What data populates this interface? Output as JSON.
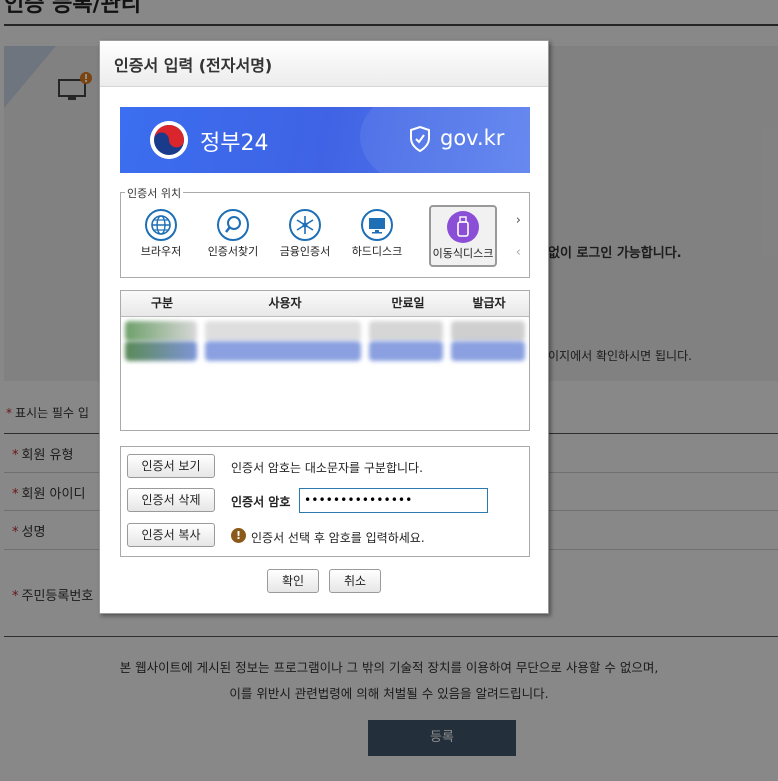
{
  "background": {
    "title": "인증 등록/관리",
    "info_line1": "없이 로그인 가능합니다.",
    "info_line2": "이지에서 확인하시면 됩니다.",
    "required_note": "표시는 필수 입",
    "fields": [
      "회원 유형",
      "회원 아이디",
      "성명",
      "주민등록번호"
    ],
    "notice_line1": "본 웹사이트에 게시된 정보는 프로그램이나 그 밖의 기술적 장치를 이용하여 무단으로 사용할 수 없으며,",
    "notice_line2": "이를 위반시 관련법령에 의해 처벌될 수 있음을 알려드립니다.",
    "register_label": "등록"
  },
  "dialog": {
    "title": "인증서 입력 (전자서명)",
    "banner": {
      "service_name": "정부24",
      "domain": "gov.kr",
      "brand_color": "#3b6ef0"
    },
    "location": {
      "legend": "인증서 위치",
      "items": [
        {
          "label": "브라우저",
          "icon": "globe-icon",
          "selected": false
        },
        {
          "label": "인증서찾기",
          "icon": "magnifier-icon",
          "selected": false
        },
        {
          "label": "금융인증서",
          "icon": "asterisk-icon",
          "selected": false
        },
        {
          "label": "하드디스크",
          "icon": "monitor-icon",
          "selected": false
        },
        {
          "label": "이동식디스크",
          "icon": "usb-icon",
          "selected": true
        }
      ],
      "next": "›",
      "prev": "‹"
    },
    "table": {
      "headers": [
        "구분",
        "사용자",
        "만료일",
        "발급자"
      ]
    },
    "buttons": {
      "view": "인증서 보기",
      "delete": "인증서 삭제",
      "copy": "인증서 복사",
      "ok": "확인",
      "cancel": "취소"
    },
    "case_notice": "인증서 암호는 대소문자를 구분합니다.",
    "password_label": "인증서 암호",
    "password_value": "•••••••••••••••",
    "warning_text": "인증서 선택 후 암호를 입력하세요."
  }
}
